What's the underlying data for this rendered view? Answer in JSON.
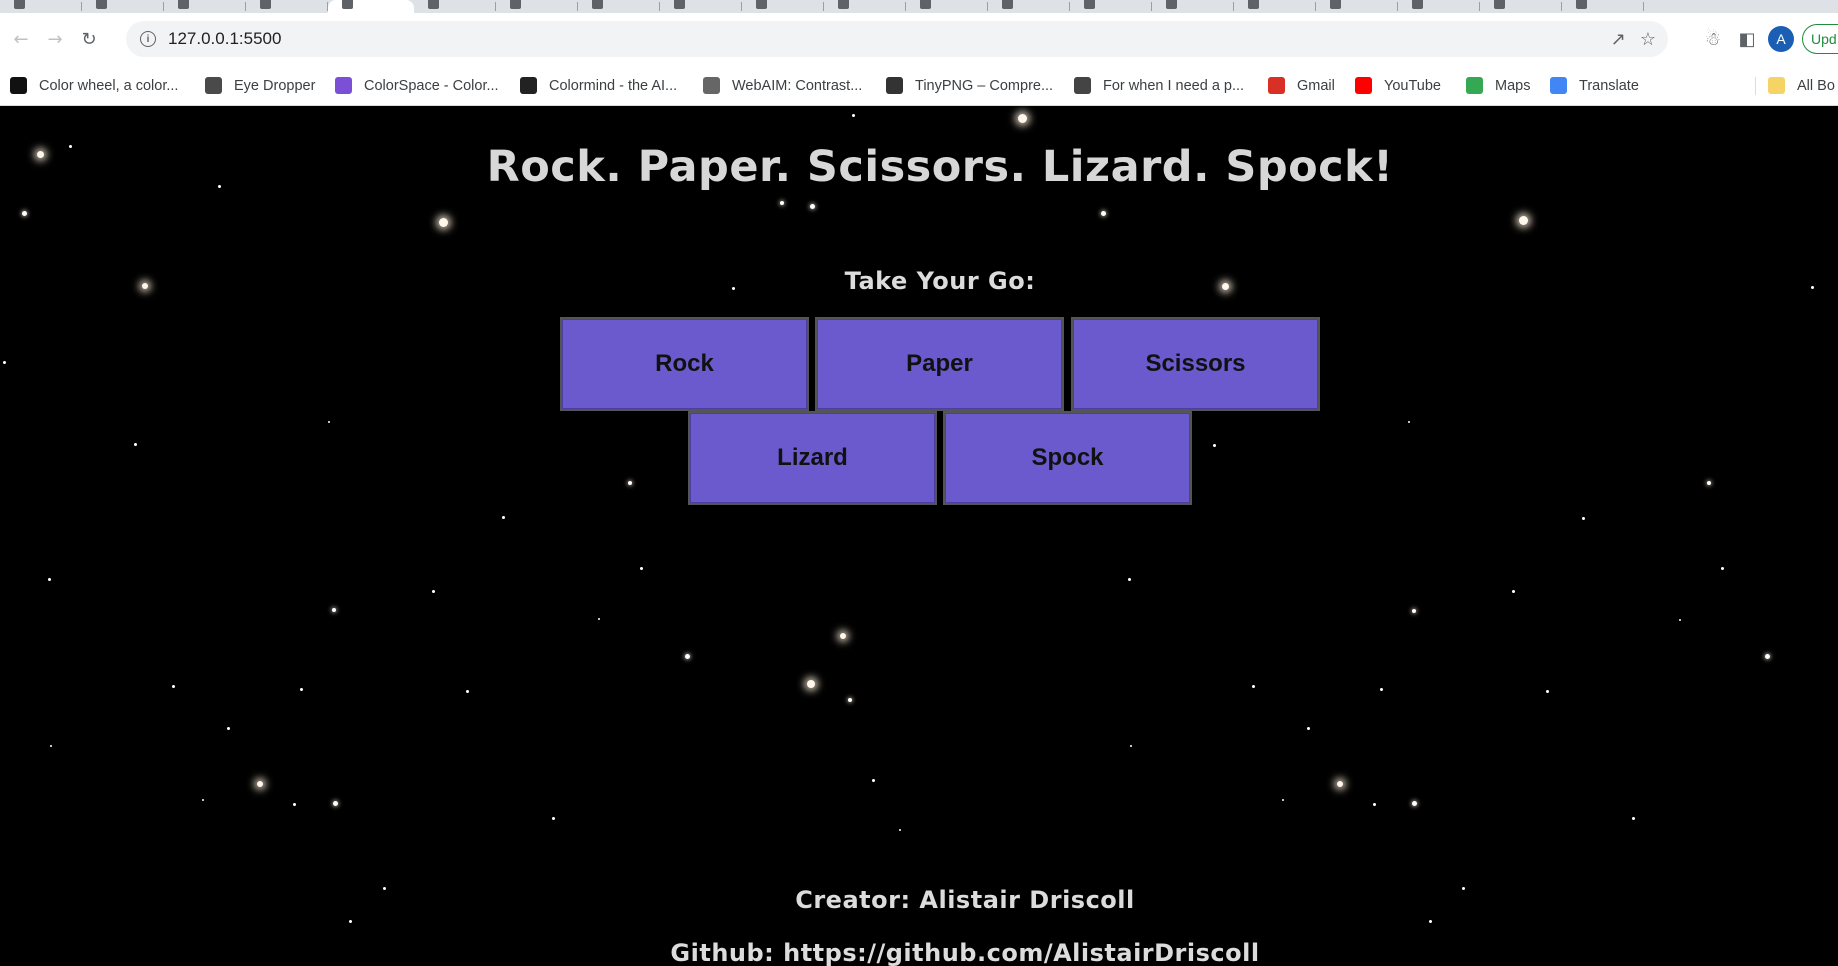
{
  "browser": {
    "address": "127.0.0.1:5500",
    "update_label": "Upd",
    "avatar_letter": "A",
    "bookmarks": [
      {
        "label": "Color wheel, a color...",
        "icon": "color-wheel-icon",
        "color": "#111111"
      },
      {
        "label": "Eye Dropper",
        "icon": "eyedropper-icon",
        "color": "#4a4a4a"
      },
      {
        "label": "ColorSpace - Color...",
        "icon": "colorspace-icon",
        "color": "#7b4fd6"
      },
      {
        "label": "Colormind - the AI...",
        "icon": "colormind-icon",
        "color": "#222222"
      },
      {
        "label": "WebAIM: Contrast...",
        "icon": "webaim-icon",
        "color": "#666666"
      },
      {
        "label": "TinyPNG – Compre...",
        "icon": "tinypng-icon",
        "color": "#333333"
      },
      {
        "label": "For when I need a p...",
        "icon": "image-icon",
        "color": "#444444"
      },
      {
        "label": "Gmail",
        "icon": "gmail-icon",
        "color": "#d93025"
      },
      {
        "label": "YouTube",
        "icon": "youtube-icon",
        "color": "#ff0000"
      },
      {
        "label": "Maps",
        "icon": "maps-icon",
        "color": "#34a853"
      },
      {
        "label": "Translate",
        "icon": "translate-icon",
        "color": "#4285f4"
      },
      {
        "label": "All Bo",
        "icon": "folder-icon",
        "color": "#f6d365"
      }
    ]
  },
  "game": {
    "title": "Rock. Paper. Scissors. Lizard. Spock!",
    "prompt": "Take Your Go:",
    "choices": [
      "Rock",
      "Paper",
      "Scissors",
      "Lizard",
      "Spock"
    ],
    "creator": "Creator: Alistair Driscoll",
    "github": "Github: https://github.com/AlistairDriscoll",
    "button_color": "#6a5acd",
    "background_color": "#000000"
  }
}
